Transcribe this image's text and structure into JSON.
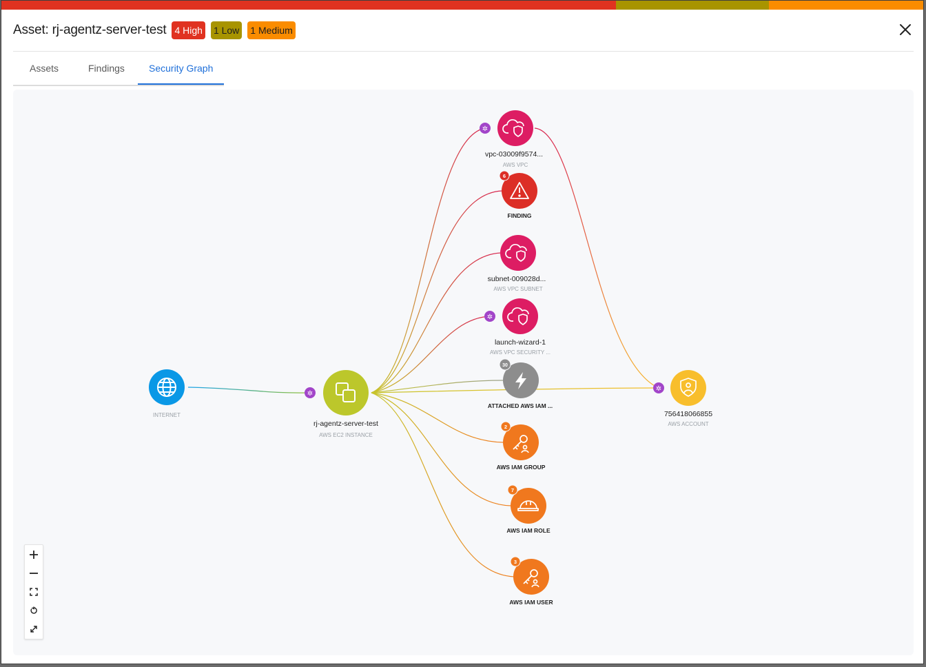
{
  "modal": {
    "title": "Asset: rj-agentz-server-test",
    "badges": [
      {
        "label": "4 High",
        "bg": "#e03220",
        "fg": "#ffffff"
      },
      {
        "label": "1 Low",
        "bg": "#a89400",
        "fg": "#1e1e1e"
      },
      {
        "label": "1 Medium",
        "bg": "#fa8c00",
        "fg": "#1e1e1e"
      }
    ],
    "severity_bar": [
      {
        "name": "high",
        "color": "#e03220",
        "fraction": 0.667
      },
      {
        "name": "low",
        "color": "#a89400",
        "fraction": 0.167
      },
      {
        "name": "medium",
        "color": "#fa8c00",
        "fraction": 0.166
      }
    ]
  },
  "tabs": [
    {
      "label": "Assets",
      "active": false
    },
    {
      "label": "Findings",
      "active": false
    },
    {
      "label": "Security Graph",
      "active": true
    }
  ],
  "graph": {
    "nodes": {
      "internet": {
        "label": "",
        "sublabel": "INTERNET",
        "color": "#0a98e6",
        "icon": "globe-icon"
      },
      "ec2": {
        "label": "rj-agentz-server-test",
        "sublabel": "AWS EC2 INSTANCE",
        "color": "#bcc72b",
        "icon": "copy-icon"
      },
      "vpc": {
        "label": "vpc-03009f9574...",
        "sublabel": "AWS VPC",
        "color": "#dd1d63",
        "icon": "cloud-shield-icon"
      },
      "finding": {
        "label": "FINDING",
        "sublabel": "",
        "count": "6",
        "color": "#dc2e26",
        "icon": "warning-icon"
      },
      "subnet": {
        "label": "subnet-009028d...",
        "sublabel": "AWS VPC SUBNET",
        "color": "#dd1d63",
        "icon": "cloud-shield-icon"
      },
      "sg": {
        "label": "launch-wizard-1",
        "sublabel": "AWS VPC SECURITY ...",
        "color": "#dd1d63",
        "icon": "cloud-shield-icon"
      },
      "policy": {
        "label": "ATTACHED AWS IAM ...",
        "sublabel": "",
        "count": "30",
        "color": "#8d8d8d",
        "icon": "lightning-icon"
      },
      "group": {
        "label": "AWS IAM GROUP",
        "sublabel": "",
        "count": "2",
        "color": "#f0781e",
        "icon": "key-user-icon"
      },
      "role": {
        "label": "AWS IAM ROLE",
        "sublabel": "",
        "count": "7",
        "color": "#f0781e",
        "icon": "hardhat-icon"
      },
      "user": {
        "label": "AWS IAM USER",
        "sublabel": "",
        "count": "3",
        "color": "#f0781e",
        "icon": "key-user-icon"
      },
      "account": {
        "label": "756418066855",
        "sublabel": "AWS ACCOUNT",
        "color": "#f8be2c",
        "icon": "shield-user-icon"
      }
    }
  },
  "zoom_controls": [
    "zoom-in-icon",
    "zoom-out-icon",
    "fit-view-icon",
    "reset-icon",
    "expand-icon"
  ]
}
